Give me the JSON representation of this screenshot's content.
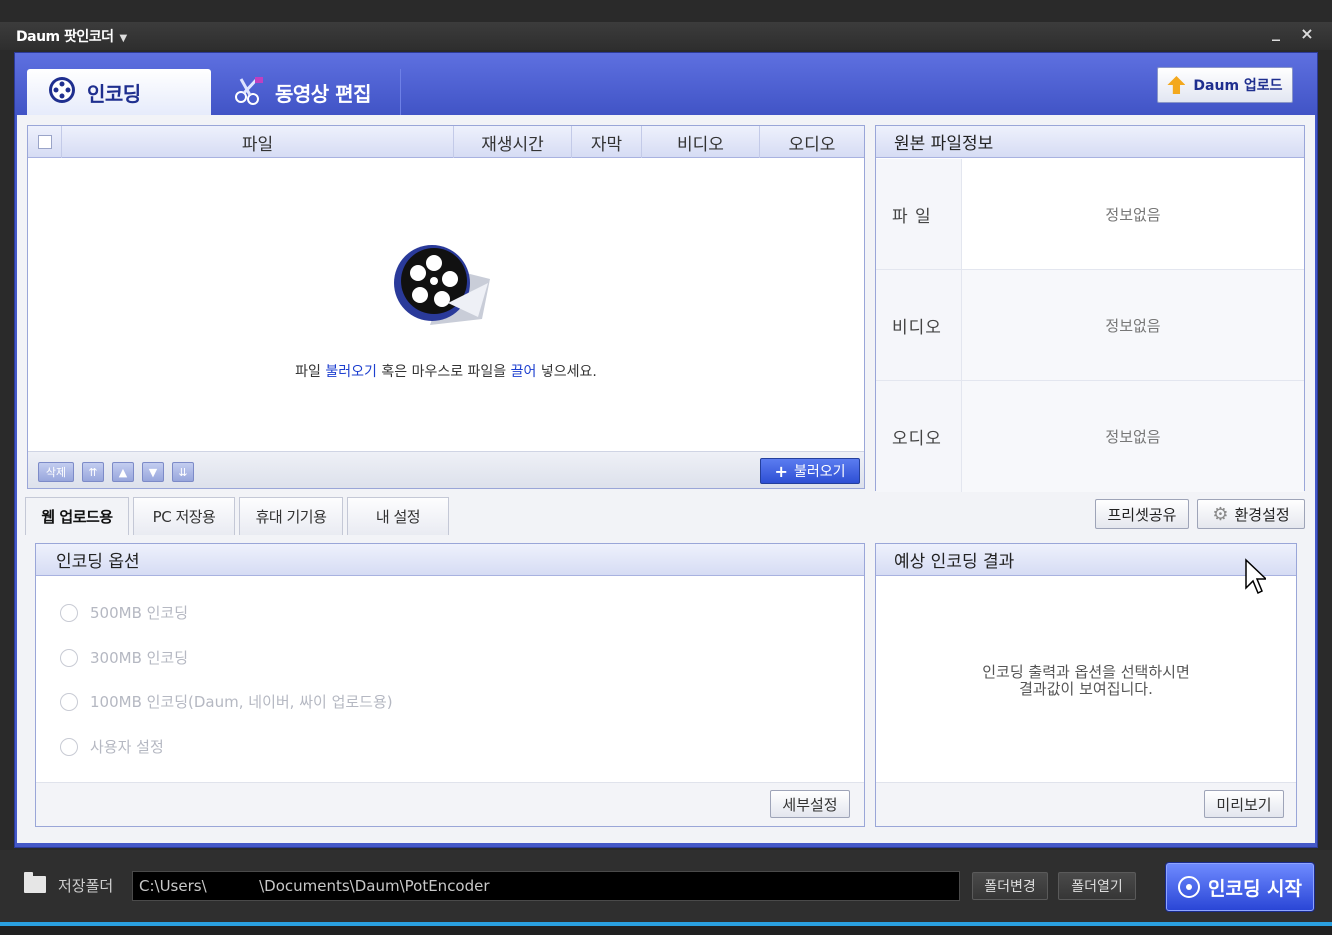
{
  "app": {
    "title": "Daum 팟인코더",
    "window_controls": {
      "minimize": "_",
      "close": "×"
    }
  },
  "main_tabs": [
    {
      "label": "인코딩",
      "icon": "film-reel-icon",
      "active": true
    },
    {
      "label": "동영상 편집",
      "icon": "scissors-icon",
      "active": false
    }
  ],
  "upload_button": {
    "label": "Daum 업로드",
    "icon": "up-arrow-icon"
  },
  "file_list": {
    "columns": [
      "파일",
      "재생시간",
      "자막",
      "비디오",
      "오디오"
    ],
    "hint": {
      "before": "파일 ",
      "link1": "불러오기",
      "middle": " 혹은 마우스로 파일을 ",
      "link2": "끌어",
      "after": " 넣으세요."
    },
    "footer": {
      "delete_label": "삭제",
      "move_top": "⇈",
      "move_up": "▲",
      "move_down": "▼",
      "move_bottom": "⇊",
      "load_label": "불러오기"
    }
  },
  "source_info": {
    "title": "원본 파일정보",
    "rows": [
      {
        "label": "파  일",
        "value": "정보없음"
      },
      {
        "label": "비디오",
        "value": "정보없음"
      },
      {
        "label": "오디오",
        "value": "정보없음"
      }
    ]
  },
  "sub_tabs": [
    {
      "label": "웹 업로드용",
      "active": true
    },
    {
      "label": "PC 저장용",
      "active": false
    },
    {
      "label": "휴대 기기용",
      "active": false
    },
    {
      "label": "내 설정",
      "active": false
    }
  ],
  "preset_share_label": "프리셋공유",
  "settings_label": "환경설정",
  "encoding_options": {
    "title": "인코딩 옵션",
    "options": [
      "500MB 인코딩",
      "300MB 인코딩",
      "100MB 인코딩(Daum, 네이버, 싸이 업로드용)",
      "사용자 설정"
    ],
    "detail_label": "세부설정"
  },
  "expected_result": {
    "title": "예상 인코딩 결과",
    "message_line1": "인코딩 출력과 옵션을 선택하시면",
    "message_line2": "결과값이 보여집니다.",
    "preview_label": "미리보기"
  },
  "bottom": {
    "save_folder_label": "저장폴더",
    "path": "C:\\Users\\           \\Documents\\Daum\\PotEncoder",
    "change_folder_label": "폴더변경",
    "open_folder_label": "폴더열기",
    "start_label": "인코딩 시작"
  },
  "colors": {
    "accent": "#4458c8",
    "link": "#1d3fcf",
    "start": "#3a56e6",
    "progress": "#2aa0e0"
  }
}
